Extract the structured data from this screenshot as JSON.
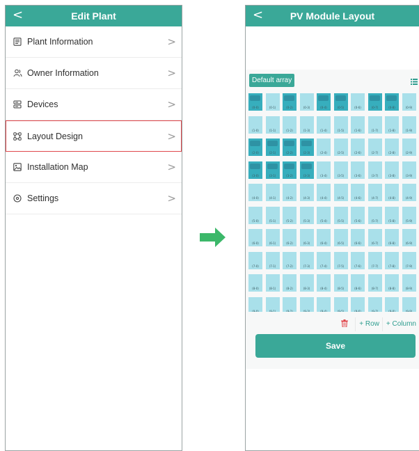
{
  "left_screen": {
    "title": "Edit Plant",
    "back_glyph": "<",
    "menu_items": [
      {
        "label": "Plant Information",
        "icon": "document-icon"
      },
      {
        "label": "Owner Information",
        "icon": "users-icon"
      },
      {
        "label": "Devices",
        "icon": "server-icon"
      },
      {
        "label": "Layout Design",
        "icon": "layout-icon",
        "selected": true
      },
      {
        "label": "Installation Map",
        "icon": "image-icon"
      },
      {
        "label": "Settings",
        "icon": "settings-icon"
      }
    ],
    "chevron": ">"
  },
  "right_screen": {
    "title": "PV Module Layout",
    "back_glyph": "<",
    "array_tab": "Default array",
    "add_row": "+ Row",
    "add_column": "+ Column",
    "save_label": "Save",
    "grid": {
      "rows": 10,
      "cols": 10,
      "highlighted": [
        [
          0,
          0
        ],
        [
          0,
          2
        ],
        [
          0,
          4
        ],
        [
          0,
          5
        ],
        [
          0,
          7
        ],
        [
          0,
          8
        ],
        [
          2,
          0
        ],
        [
          2,
          1
        ],
        [
          2,
          2
        ],
        [
          2,
          3
        ],
        [
          3,
          0
        ],
        [
          3,
          1
        ],
        [
          3,
          2
        ],
        [
          3,
          3
        ]
      ],
      "cell_labels_format": "(r-c)"
    }
  },
  "colors": {
    "accent": "#3aa898",
    "cell_light": "#a9e0ea",
    "cell_dark": "#37aebd",
    "selection_red": "#e0474c",
    "arrow_green": "#3cb86a"
  }
}
